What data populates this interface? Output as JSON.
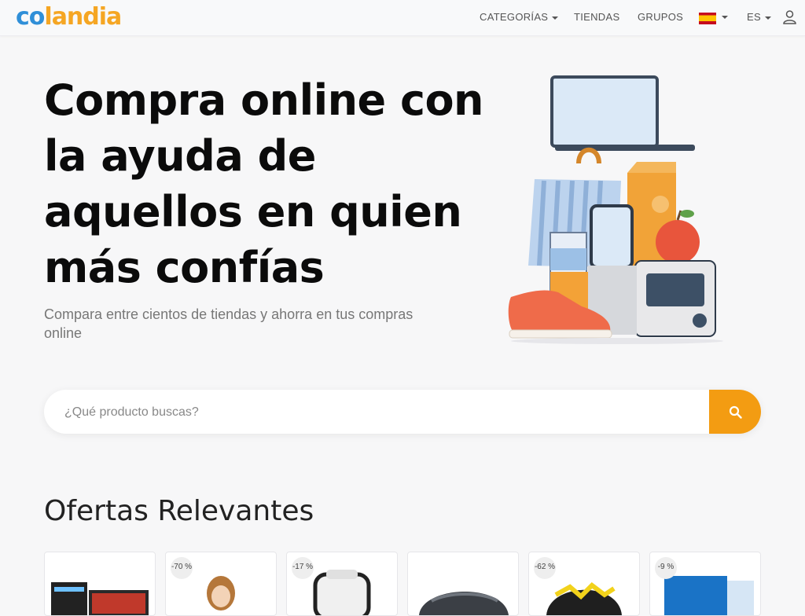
{
  "header": {
    "logo": {
      "part1": "co",
      "part2": "landia"
    },
    "nav": {
      "categories": "CATEGORÍAS",
      "stores": "TIENDAS",
      "groups": "GRUPOS",
      "language": "ES"
    },
    "flag_icon": "spain-flag-icon",
    "user_icon": "user-icon"
  },
  "hero": {
    "title": "Compra online con la ayuda de aquellos en quien más confías",
    "subtitle": "Compara entre cientos de tiendas y ahorra en tus compras online"
  },
  "search": {
    "placeholder": "¿Qué producto buscas?",
    "button_icon": "search-icon"
  },
  "offers": {
    "title": "Ofertas Relevantes",
    "cards": [
      {
        "badge": "",
        "product": "gaming-pc"
      },
      {
        "badge": "-70 %",
        "product": "doll"
      },
      {
        "badge": "-17 %",
        "product": "office-chair"
      },
      {
        "badge": "",
        "product": "helmet"
      },
      {
        "badge": "-62 %",
        "product": "bike-helmet"
      },
      {
        "badge": "-9 %",
        "product": "box"
      }
    ]
  },
  "colors": {
    "accent": "#f39c12",
    "logo_blue": "#2f8fd8",
    "logo_orange": "#f5a623"
  }
}
